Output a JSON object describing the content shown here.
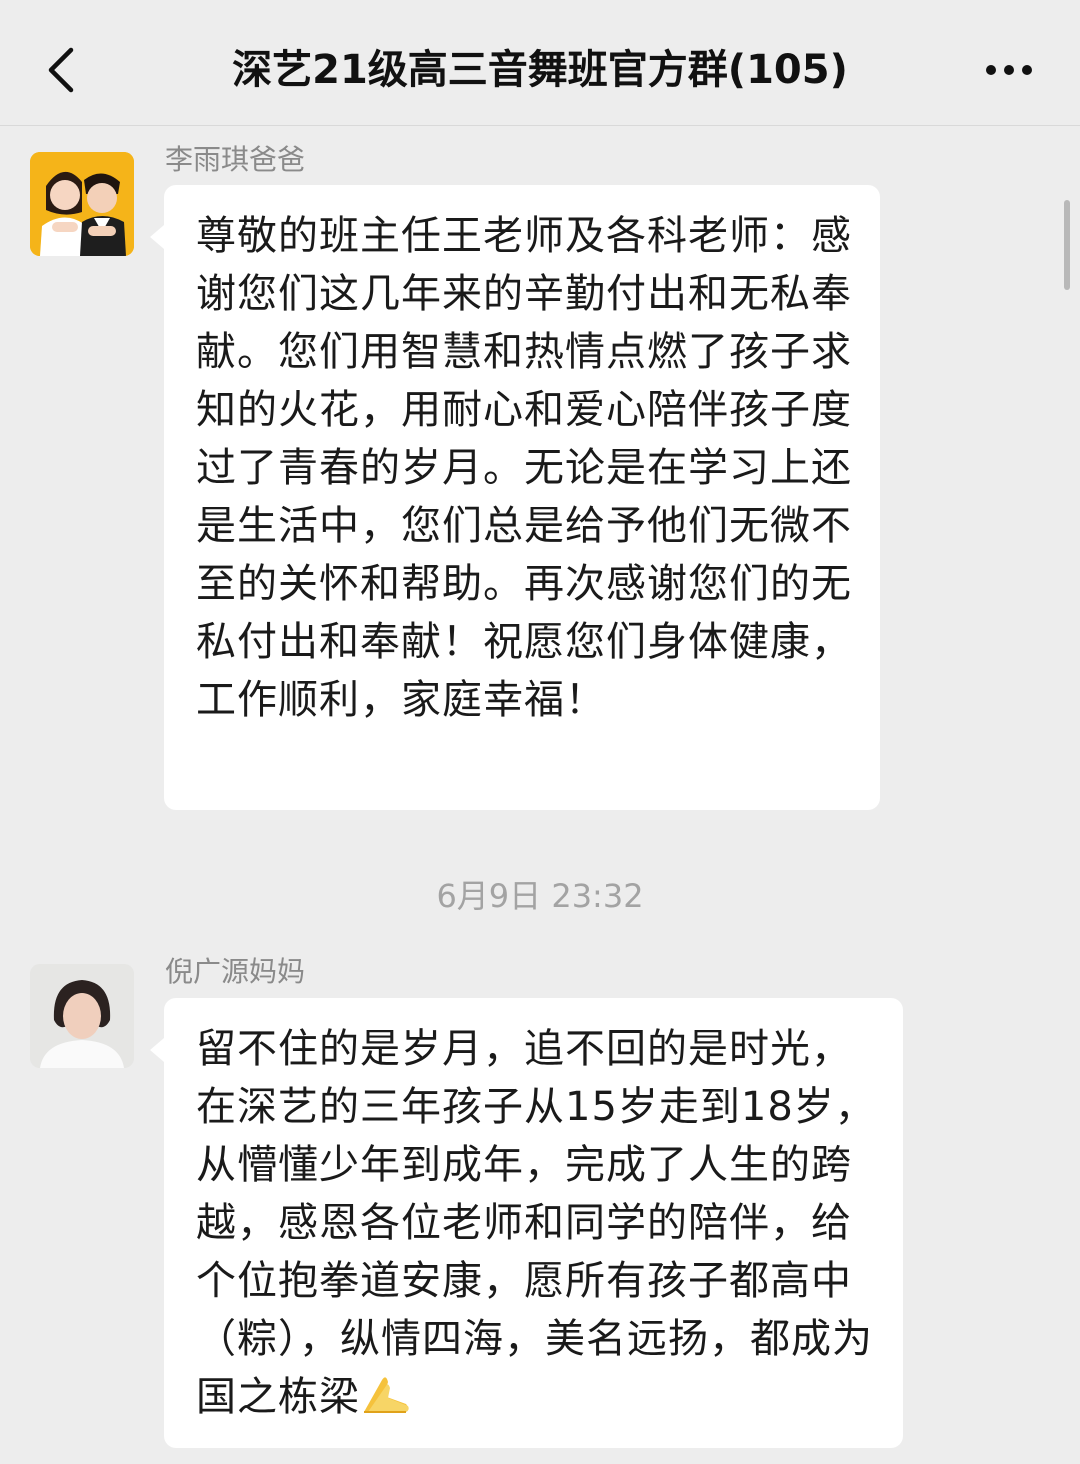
{
  "header": {
    "title": "深艺21级高三音舞班官方群(105)",
    "back_icon": "chevron-left-icon",
    "more_icon": "more-dots-icon"
  },
  "messages": [
    {
      "sender": "李雨琪爸爸",
      "avatar": "avatar-two-children",
      "text": "尊敬的班主任王老师及各科老师：感谢您们这几年来的辛勤付出和无私奉献。您们用智慧和热情点燃了孩子求知的火花，用耐心和爱心陪伴孩子度过了青春的岁月。无论是在学习上还是生活中，您们总是给予他们无微不至的关怀和帮助。再次感谢您们的无私付出和奉献！祝愿您们身体健康，工作顺利，家庭幸福！"
    },
    {
      "sender": "倪广源妈妈",
      "avatar": "avatar-woman",
      "text": "留不住的是岁月，追不回的是时光，在深艺的三年孩子从15岁走到18岁，从懵懂少年到成年，完成了人生的跨越，感恩各位老师和同学的陪伴，给个位抱拳道安康，愿所有孩子都高中（粽），纵情四海，美名远扬，都成为国之栋梁",
      "emoji": "folded-hands-icon"
    }
  ],
  "timestamp": "6月9日 23:32",
  "colors": {
    "background": "#ededed",
    "bubble": "#ffffff",
    "meta_text": "#8a8a8a"
  }
}
